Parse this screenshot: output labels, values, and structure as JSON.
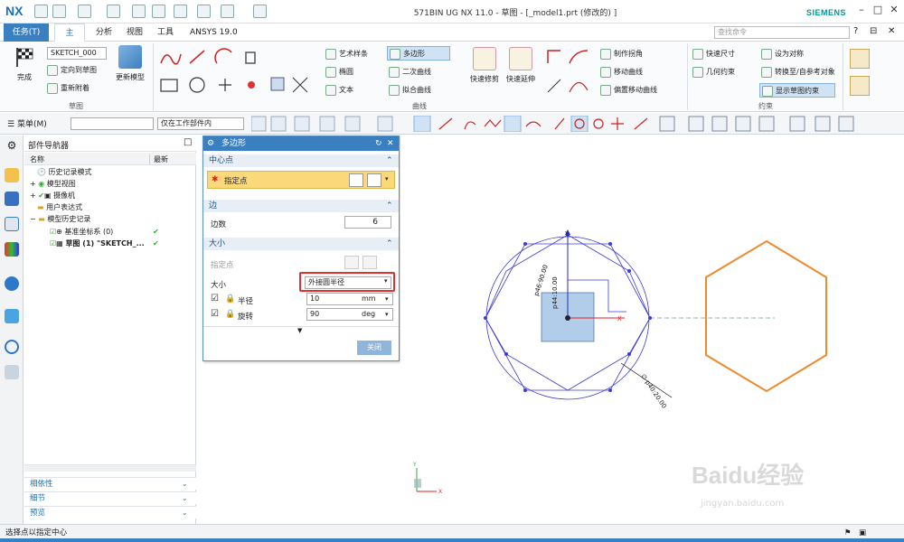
{
  "app": {
    "logo": "NX",
    "title": "571BIN UG NX 11.0 - 草图 - [_model1.prt  (修改的) ]",
    "brand": "SIEMENS",
    "search_placeholder": "查找命令"
  },
  "tabs": [
    "任务(T)",
    "主页",
    "分析",
    "视图",
    "工具",
    "ANSYS 19.0"
  ],
  "ribbon": {
    "sketch_group": {
      "sketch_name": "SKETCH_000",
      "finish": "完成",
      "orient": "定向到草图",
      "reattach": "重新附着",
      "update_model": "更新模型",
      "label": "草图"
    },
    "curve_group": {
      "art_spline": "艺术样条",
      "polygon": "多边形",
      "ellipse": "椭圆",
      "conic": "二次曲线",
      "text": "文本",
      "fit_curve": "拟合曲线",
      "quick_trim": "快速修剪",
      "quick_extend": "快速延伸",
      "make_corner": "制作拐角",
      "move_curve": "移动曲线",
      "offset_move_curve": "偏置移动曲线",
      "label": "曲线"
    },
    "constraint_group": {
      "rapid_dim": "快速尺寸",
      "geo_constraint": "几何约束",
      "set_symmetric": "设为对称",
      "convert_ref": "转换至/自参考对象",
      "show_constraints": "显示草图约束",
      "label": "约束"
    }
  },
  "toolbar": {
    "menu": "菜单(M)",
    "filter_value": "",
    "scope_value": "仅在工作部件内"
  },
  "navigator": {
    "title": "部件导航器",
    "col_name": "名称",
    "col_latest": "最新",
    "tree": [
      {
        "label": "历史记录模式",
        "indent": 0
      },
      {
        "label": "模型视图",
        "indent": 0
      },
      {
        "label": "摄像机",
        "indent": 0
      },
      {
        "label": "用户表达式",
        "indent": 0
      },
      {
        "label": "模型历史记录",
        "indent": 0
      },
      {
        "label": "基准坐标系 (0)",
        "indent": 1,
        "check": "✔"
      },
      {
        "label": "草图 (1) \"SKETCH_...",
        "indent": 1,
        "check": "✔"
      }
    ],
    "footer": [
      "相依性",
      "细节",
      "预览"
    ]
  },
  "dialog": {
    "title": "多边形",
    "center_section": "中心点",
    "specify_point": "指定点",
    "edge_section": "边",
    "sides_label": "边数",
    "sides_value": "6",
    "size_section": "大小",
    "size_point_label": "指定点",
    "size_label": "大小",
    "size_value": "外接圆半径",
    "radius_label": "半径",
    "radius_value": "10",
    "radius_unit": "mm",
    "rotation_label": "旋转",
    "rotation_value": "90",
    "rotation_unit": "deg",
    "close": "关闭"
  },
  "canvas": {
    "dim_top1": "p46:90.00",
    "dim_top2": "p44:10.00",
    "dim_diag": "∅ p40:20.00",
    "axis_y": "Y",
    "axis_x": "X",
    "accent": "#ee8a2e",
    "sketch_color": "#3b3bd6"
  },
  "status": {
    "text": "选择点以指定中心"
  },
  "watermark": {
    "baidu": "Baidu经验",
    "url": "jingyan.baidu.com"
  }
}
